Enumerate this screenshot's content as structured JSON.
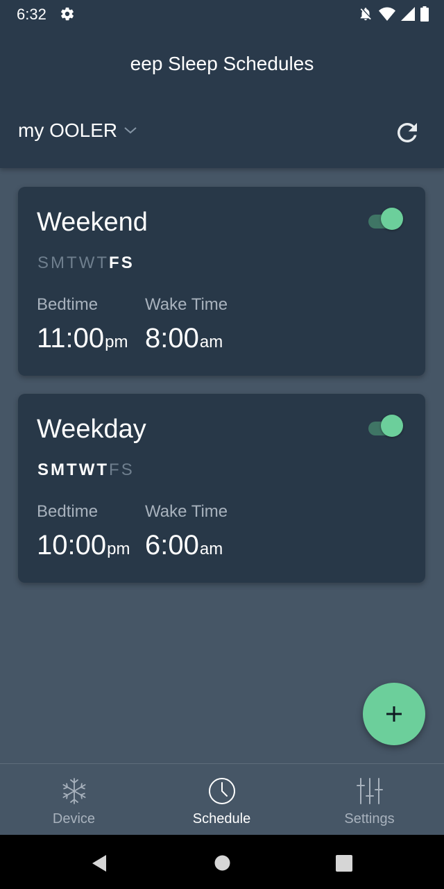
{
  "status_bar": {
    "time": "6:32"
  },
  "header": {
    "title": "eep Sleep Schedules",
    "device_name": "my OOLER"
  },
  "schedules": [
    {
      "name": "Weekend",
      "enabled": true,
      "days": [
        {
          "letter": "S",
          "active": false
        },
        {
          "letter": "M",
          "active": false
        },
        {
          "letter": "T",
          "active": false
        },
        {
          "letter": "W",
          "active": false
        },
        {
          "letter": "T",
          "active": false
        },
        {
          "letter": "F",
          "active": true
        },
        {
          "letter": "S",
          "active": true
        }
      ],
      "bedtime_label": "Bedtime",
      "bedtime_time": "11:00",
      "bedtime_suffix": "pm",
      "wake_label": "Wake Time",
      "wake_time": "8:00",
      "wake_suffix": "am"
    },
    {
      "name": "Weekday",
      "enabled": true,
      "days": [
        {
          "letter": "S",
          "active": true
        },
        {
          "letter": "M",
          "active": true
        },
        {
          "letter": "T",
          "active": true
        },
        {
          "letter": "W",
          "active": true
        },
        {
          "letter": "T",
          "active": true
        },
        {
          "letter": "F",
          "active": false
        },
        {
          "letter": "S",
          "active": false
        }
      ],
      "bedtime_label": "Bedtime",
      "bedtime_time": "10:00",
      "bedtime_suffix": "pm",
      "wake_label": "Wake Time",
      "wake_time": "6:00",
      "wake_suffix": "am"
    }
  ],
  "bottom_nav": {
    "device": "Device",
    "schedule": "Schedule",
    "settings": "Settings",
    "active": "schedule"
  },
  "colors": {
    "background": "#465666",
    "header": "#2a3a4b",
    "card": "#283848",
    "accent": "#6ccf9b"
  }
}
